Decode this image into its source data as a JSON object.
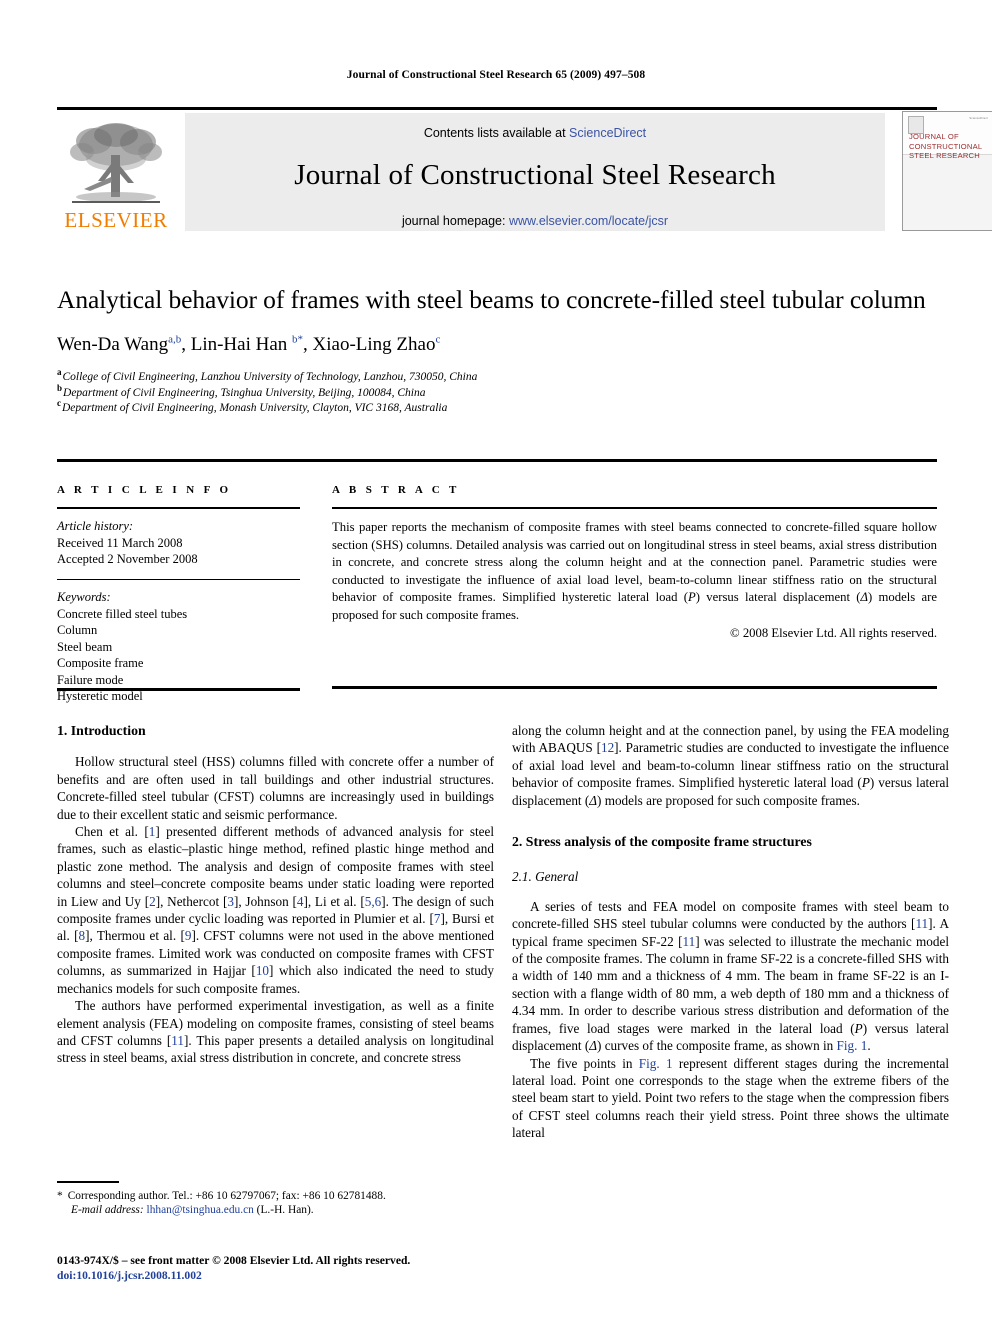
{
  "running_head": "Journal of Constructional Steel Research 65 (2009) 497–508",
  "masthead": {
    "contents_prefix": "Contents lists available at ",
    "contents_link": "ScienceDirect",
    "journal_title": "Journal of Constructional Steel Research",
    "homepage_prefix": "journal homepage: ",
    "homepage_url": "www.elsevier.com/locate/jcsr",
    "publisher_name": "ELSEVIER",
    "cover_title": "JOURNAL OF CONSTRUCTIONAL STEEL RESEARCH",
    "cover_corner_text": "ScienceDirect",
    "link_color": "#3a53a4",
    "publisher_color": "#f07d00",
    "cover_title_color": "#9d2e2e"
  },
  "title": "Analytical behavior of frames with steel beams to concrete-filled steel tubular column",
  "authors": [
    {
      "name": "Wen-Da Wang",
      "marks": "a,b",
      "sep": ", "
    },
    {
      "name": "Lin-Hai Han ",
      "marks": "b*",
      "sep": ", "
    },
    {
      "name": "Xiao-Ling Zhao",
      "marks": "c",
      "sep": ""
    }
  ],
  "affiliations": [
    {
      "mark": "a",
      "text": "College of Civil Engineering, Lanzhou University of Technology, Lanzhou, 730050, China"
    },
    {
      "mark": "b",
      "text": "Department of Civil Engineering, Tsinghua University, Beijing, 100084, China"
    },
    {
      "mark": "c",
      "text": "Department of Civil Engineering, Monash University, Clayton, VIC 3168, Australia"
    }
  ],
  "article_info": {
    "kicker": "A R T I C L E   I N F O",
    "history_label": "Article history:",
    "history": [
      "Received 11 March 2008",
      "Accepted 2 November 2008"
    ],
    "keywords_label": "Keywords:",
    "keywords": [
      "Concrete filled steel tubes",
      "Column",
      "Steel beam",
      "Composite frame",
      "Failure mode",
      "Hysteretic model"
    ]
  },
  "abstract": {
    "kicker": "A B S T R A C T",
    "part1": "This paper reports the mechanism of composite frames with steel beams connected to concrete-filled square hollow section (SHS) columns. Detailed analysis was carried out on longitudinal stress in steel beams, axial stress distribution in concrete, and concrete stress along the column height and at the connection panel. Parametric studies were conducted to investigate the influence of axial load level, beam-to-column linear stiffness ratio on the structural behavior of composite frames. Simplified hysteretic lateral load (",
    "sym_p": "P",
    "part2": ") versus lateral displacement (",
    "sym_delta": "Δ",
    "part3": ") models are proposed for such composite frames.",
    "copyright": "© 2008 Elsevier Ltd. All rights reserved."
  },
  "body": {
    "left": {
      "heading1": "1.  Introduction",
      "para1": "Hollow structural steel (HSS) columns filled with concrete offer a number of benefits and are often used in tall buildings and other industrial structures. Concrete-filled steel tubular (CFST) columns are increasingly used in buildings due to their excellent static and seismic performance.",
      "para2_a": "Chen et al. [",
      "r1": "1",
      "para2_b": "] presented different methods of advanced analysis for steel frames, such as elastic–plastic hinge method, refined plastic hinge method and plastic zone method. The analysis and design of composite frames with steel columns and steel–concrete composite beams under static loading were reported in Liew and Uy [",
      "r2": "2",
      "para2_c": "], Nethercot [",
      "r3": "3",
      "para2_d": "], Johnson [",
      "r4": "4",
      "para2_e": "], Li et al. [",
      "r56": "5,6",
      "para2_f": "]. The design of such composite frames under cyclic loading was reported in Plumier et al. [",
      "r7": "7",
      "para2_g": "], Bursi et al. [",
      "r8": "8",
      "para2_h": "], Thermou et al. [",
      "r9": "9",
      "para2_i": "]. CFST columns were not used in the above mentioned composite frames. Limited work was conducted on composite frames with CFST columns, as summarized in Hajjar [",
      "r10": "10",
      "para2_j": "] which also indicated the need to study mechanics models for such composite frames.",
      "para3_a": "The authors have performed experimental investigation, as well as a finite element analysis (FEA) modeling on composite frames, consisting of steel beams and CFST columns [",
      "r11": "11",
      "para3_b": "]. This paper presents a detailed analysis on longitudinal stress in steel beams, axial stress distribution in concrete, and concrete stress"
    },
    "right": {
      "para1_a": "along the column height and at the connection panel, by using the FEA modeling with ABAQUS [",
      "r12": "12",
      "para1_b": "]. Parametric studies are conducted to investigate the influence of axial load level and beam-to-column linear stiffness ratio on the structural behavior of composite frames. Simplified hysteretic lateral load (",
      "sym_p": "P",
      "para1_c": ") versus lateral displacement (",
      "sym_delta": "Δ",
      "para1_d": ") models are proposed for such composite frames.",
      "heading2": "2.  Stress analysis of the composite frame structures",
      "heading21": "2.1.  General",
      "para2_a": "A series of tests and FEA model on composite frames with steel beam to concrete-filled SHS steel tubular columns were conducted by the authors [",
      "r11a": "11",
      "para2_b": "]. A typical frame specimen SF-22 [",
      "r11b": "11",
      "para2_c": "] was selected to illustrate the mechanic model of the composite frames. The column in frame SF-22 is a concrete-filled SHS with a width of 140 mm and a thickness of 4 mm. The beam in frame SF-22 is an I-section with a flange width of 80 mm, a web depth of 180 mm and a thickness of 4.34 mm. In order to describe various stress distribution and deformation of the frames, five load stages were marked in the lateral load (",
      "sym_p2": "P",
      "para2_d": ") versus lateral displacement (",
      "sym_delta2": "Δ",
      "para2_e": ") curves of the composite frame, as shown in ",
      "fig_ref_1": "Fig. 1",
      "para2_f": ".",
      "para3_a": "The five points in ",
      "fig_ref_2": "Fig. 1",
      "para3_b": " represent different stages during the incremental lateral load. Point one corresponds to the stage when the extreme fibers of the steel beam start to yield. Point two refers to the stage when the compression fibers of CFST steel columns reach their yield stress. Point three shows the ultimate lateral"
    }
  },
  "footnote": {
    "star": "*",
    "line1": "Corresponding author. Tel.: +86 10 62797067; fax: +86 10 62781488.",
    "email_label": "E-mail address:",
    "email": "lhhan@tsinghua.edu.cn",
    "email_suffix": " (L.-H. Han)."
  },
  "imprint": {
    "line1": "0143-974X/$ – see front matter © 2008 Elsevier Ltd. All rights reserved.",
    "doi": "doi:10.1016/j.jcsr.2008.11.002"
  }
}
